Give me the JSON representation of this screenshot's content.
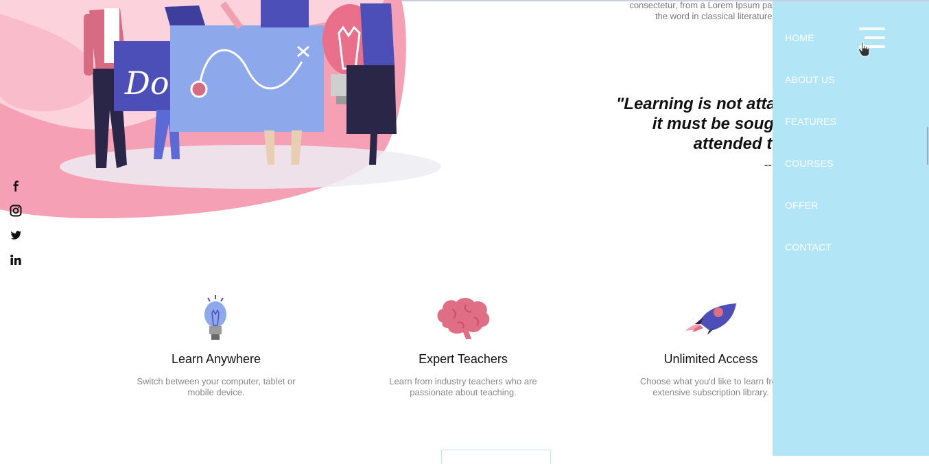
{
  "about": {
    "line1": "consectetur, from a Lorem Ipsum passage, and goi",
    "line2": "the word in classical literature, discovered th"
  },
  "quote": {
    "line1": "\"Learning is not attained",
    "line2": "it must be sought fo",
    "line3": "attended to wit",
    "dash": "--"
  },
  "social": [
    {
      "name": "facebook-icon"
    },
    {
      "name": "instagram-icon"
    },
    {
      "name": "twitter-icon"
    },
    {
      "name": "linkedin-icon"
    }
  ],
  "features": [
    {
      "title": "Learn Anywhere",
      "desc1": "Switch between your computer, tablet or",
      "desc2": "mobile device.",
      "icon": "lightbulb-icon"
    },
    {
      "title": "Expert Teachers",
      "desc1": "Learn from industry teachers who are",
      "desc2": "passionate about teaching.",
      "icon": "brain-icon"
    },
    {
      "title": "Unlimited Access",
      "desc1": "Choose what you'd like to learn fron",
      "desc2": "extensive subscription library.",
      "icon": "rocket-icon"
    }
  ],
  "menu": {
    "items": [
      "HOME",
      "ABOUT US",
      "FEATURES",
      "COURSES",
      "OFFER",
      "CONTACT"
    ]
  },
  "colors": {
    "menu_bg": "#b2e6f7",
    "hero_pink": "#f6a0b6",
    "board_blue": "#8ea8ec",
    "accent_purple": "#4d4fb8"
  }
}
